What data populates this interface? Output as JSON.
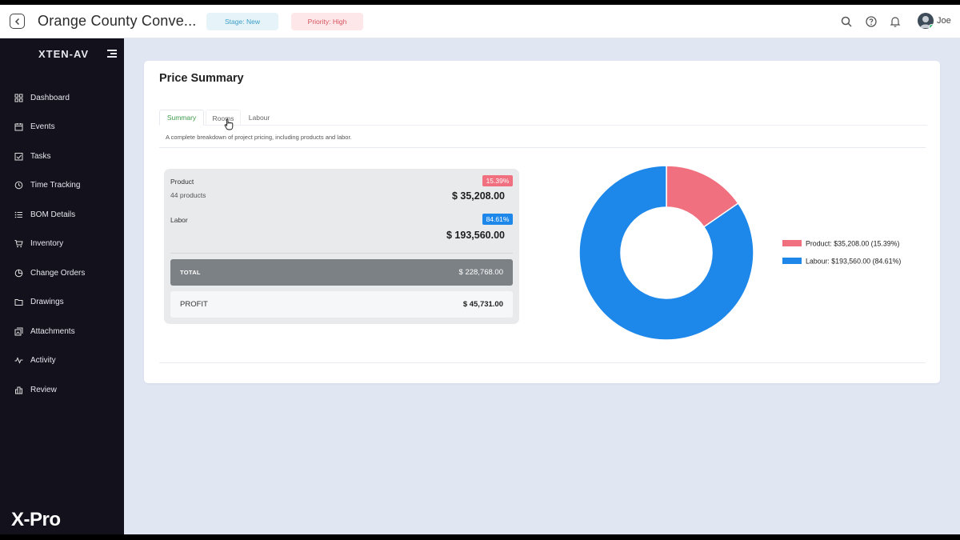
{
  "header": {
    "title": "Orange County Conve...",
    "stage": "Stage: New",
    "priority": "Priority: High",
    "user": "Joe"
  },
  "sidebar": {
    "brand": "XTEN-AV",
    "items": [
      {
        "label": "Dashboard",
        "icon": "grid-icon"
      },
      {
        "label": "Events",
        "icon": "calendar-icon"
      },
      {
        "label": "Tasks",
        "icon": "checkbox-icon"
      },
      {
        "label": "Time Tracking",
        "icon": "clock-icon"
      },
      {
        "label": "BOM Details",
        "icon": "list-icon"
      },
      {
        "label": "Inventory",
        "icon": "cart-icon"
      },
      {
        "label": "Change Orders",
        "icon": "pie-icon"
      },
      {
        "label": "Drawings",
        "icon": "folder-icon"
      },
      {
        "label": "Attachments",
        "icon": "attachment-icon"
      },
      {
        "label": "Activity",
        "icon": "pulse-icon"
      },
      {
        "label": "Review",
        "icon": "bar-chart-icon"
      }
    ],
    "footer_logo": "X-Pro"
  },
  "page": {
    "title": "Price Summary",
    "tabs": [
      "Summary",
      "Rooms",
      "Labour"
    ],
    "active_tab": "Summary",
    "description": "A complete breakdown of project pricing, including products and labor."
  },
  "summary": {
    "product_label": "Product",
    "product_count": "44 products",
    "product_pct": "15.39%",
    "product_amount": "$ 35,208.00",
    "labor_label": "Labor",
    "labor_pct": "84.61%",
    "labor_amount": "$ 193,560.00",
    "total_label": "TOTAL",
    "total_amount": "$ 228,768.00",
    "profit_label": "PROFIT",
    "profit_amount": "$ 45,731.00"
  },
  "colors": {
    "product": "#f0707f",
    "labour": "#1e88ea",
    "active_tab": "#3f9a49"
  },
  "chart_data": {
    "type": "pie",
    "donut": true,
    "categories": [
      "Product",
      "Labour"
    ],
    "values": [
      35208.0,
      193560.0
    ],
    "percentages": [
      15.39,
      84.61
    ],
    "legend": [
      "Product: $35,208.00 (15.39%)",
      "Labour: $193,560.00 (84.61%)"
    ],
    "legend_position": "right",
    "colors": [
      "#f0707f",
      "#1e88ea"
    ]
  }
}
